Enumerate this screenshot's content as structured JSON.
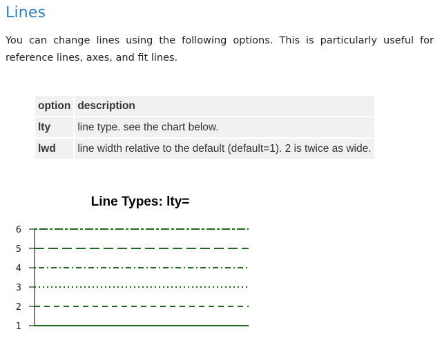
{
  "heading": "Lines",
  "intro": "You can change lines using the following options. This is particularly useful for reference lines, axes, and fit lines.",
  "table": {
    "headers": [
      "option",
      "description"
    ],
    "rows": [
      {
        "option": "lty",
        "description": "line type. see the chart below."
      },
      {
        "option": "lwd",
        "description": "line width relative to the default (default=1). 2 is twice as wide."
      }
    ]
  },
  "colors": {
    "heading": "#2f7fc0",
    "line": "#1e6b1e",
    "table_bg": "#f1f1f1"
  },
  "chart_data": {
    "type": "line",
    "title": "Line Types: lty=",
    "xlabel": "",
    "ylabel": "",
    "y_ticks": [
      "1",
      "2",
      "3",
      "4",
      "5",
      "6"
    ],
    "ylim": [
      1,
      6
    ],
    "grid": false,
    "series": [
      {
        "lty": 1,
        "style": "solid",
        "values": [
          1,
          1
        ]
      },
      {
        "lty": 2,
        "style": "dashed",
        "values": [
          2,
          2
        ]
      },
      {
        "lty": 3,
        "style": "dotted",
        "values": [
          3,
          3
        ]
      },
      {
        "lty": 4,
        "style": "dotdash",
        "values": [
          4,
          4
        ]
      },
      {
        "lty": 5,
        "style": "longdash",
        "values": [
          5,
          5
        ]
      },
      {
        "lty": 6,
        "style": "twodash",
        "values": [
          6,
          6
        ]
      }
    ]
  }
}
